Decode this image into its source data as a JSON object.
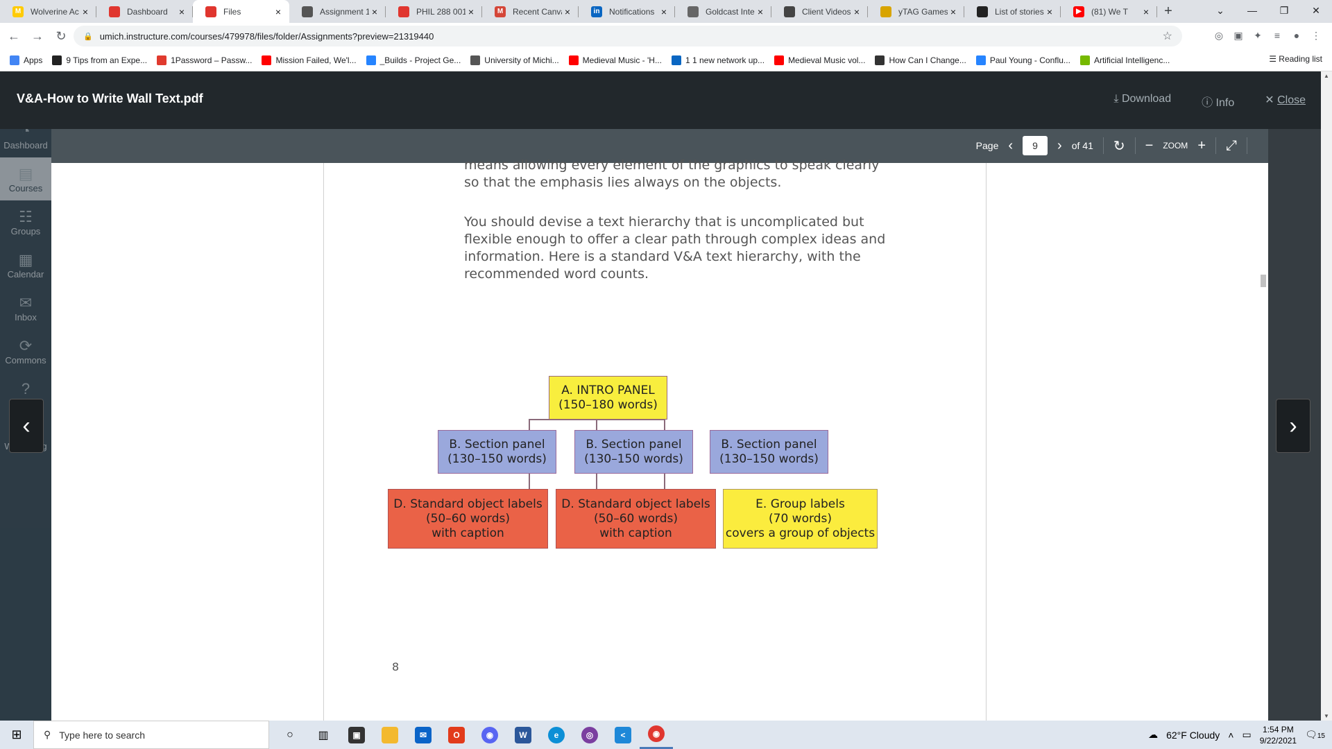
{
  "browser": {
    "tabs": [
      {
        "label": "Wolverine Ac",
        "color": "#ffcb05",
        "glyph": "M",
        "active": false
      },
      {
        "label": "Dashboard",
        "color": "#e0362f",
        "glyph": "",
        "active": false
      },
      {
        "label": "Files",
        "color": "#e0362f",
        "glyph": "",
        "active": true
      },
      {
        "label": "Assignment 1",
        "color": "#555",
        "glyph": "",
        "active": false
      },
      {
        "label": "PHIL 288 001",
        "color": "#e0362f",
        "glyph": "",
        "active": false
      },
      {
        "label": "Recent Canva",
        "color": "#d44638",
        "glyph": "M",
        "active": false
      },
      {
        "label": "Notifications",
        "color": "#0a66c2",
        "glyph": "in",
        "active": false
      },
      {
        "label": "Goldcast Inte",
        "color": "#666",
        "glyph": "",
        "active": false
      },
      {
        "label": "Client Videos",
        "color": "#444",
        "glyph": "",
        "active": false
      },
      {
        "label": "yTAG Games",
        "color": "#d8a400",
        "glyph": "",
        "active": false
      },
      {
        "label": "List of stories",
        "color": "#222",
        "glyph": "",
        "active": false
      },
      {
        "label": "(81) We T",
        "color": "#ff0000",
        "glyph": "▶",
        "active": false
      }
    ],
    "url": "umich.instructure.com/courses/479978/files/folder/Assignments?preview=21319440",
    "bookmarks": [
      {
        "label": "Apps",
        "color": "#4285f4"
      },
      {
        "label": "9 Tips from an Expe...",
        "color": "#222"
      },
      {
        "label": "1Password – Passw...",
        "color": "#e03a2e"
      },
      {
        "label": "Mission Failed, We'l...",
        "color": "#ff0000"
      },
      {
        "label": "_Builds - Project Ge...",
        "color": "#2684ff"
      },
      {
        "label": "University of Michi...",
        "color": "#555"
      },
      {
        "label": "Medieval Music - 'H...",
        "color": "#ff0000"
      },
      {
        "label": "1 1 new network up...",
        "color": "#0a66c2"
      },
      {
        "label": "Medieval Music vol...",
        "color": "#ff0000"
      },
      {
        "label": "How Can I Change...",
        "color": "#333"
      },
      {
        "label": "Paul Young - Conflu...",
        "color": "#2684ff"
      },
      {
        "label": "Artificial Intelligenc...",
        "color": "#76b900"
      }
    ],
    "reading_list": "Reading list"
  },
  "canvas_nav": [
    {
      "label": "Account",
      "icon": "avatar"
    },
    {
      "label": "Dashboard",
      "icon": "dashboard-icon"
    },
    {
      "label": "Courses",
      "icon": "book-icon"
    },
    {
      "label": "Groups",
      "icon": "groups-icon"
    },
    {
      "label": "Calendar",
      "icon": "calendar-icon"
    },
    {
      "label": "Inbox",
      "icon": "inbox-icon"
    },
    {
      "label": "Commons",
      "icon": "commons-icon"
    },
    {
      "label": "Help",
      "icon": "help-icon"
    },
    {
      "label": "Well-being",
      "icon": "wellbeing-icon"
    }
  ],
  "preview": {
    "filename": "V&A-How to Write Wall Text.pdf",
    "download": "Download",
    "info": "Info",
    "close": "Close",
    "page_label": "Page",
    "page_current": "9",
    "page_total": "of 41",
    "zoom_label": "ZOOM"
  },
  "pdf": {
    "para_top_partial": "means allowing every element of the graphics to speak clearly so that the emphasis lies always on the objects.",
    "para_main": "You should devise a text hierarchy that is uncomplicated but flexible enough to offer a clear path through complex ideas and information. Here is a standard V&A text hierarchy, with the recommended word counts.",
    "box_a": {
      "title": "A. INTRO PANEL",
      "count": "(150–180 words)"
    },
    "box_b": [
      {
        "title": "B. Section panel",
        "count": "(130–150 words)"
      },
      {
        "title": "B. Section panel",
        "count": "(130–150 words)"
      },
      {
        "title": "B. Section panel",
        "count": "(130–150 words)"
      }
    ],
    "box_d1": {
      "title": "D. Standard object labels",
      "count": "(50–60 words)",
      "note": "with caption"
    },
    "box_d2": {
      "title": "D. Standard object labels",
      "count": "(50–60 words)",
      "note": "with caption"
    },
    "box_e": {
      "title": "E. Group labels",
      "count": "(70 words)",
      "note": "covers a group of objects"
    },
    "page_number": "8"
  },
  "taskbar": {
    "search_placeholder": "Type here to search",
    "weather": "62°F  Cloudy",
    "time": "1:54 PM",
    "date": "9/22/2021",
    "notifications": "15"
  }
}
